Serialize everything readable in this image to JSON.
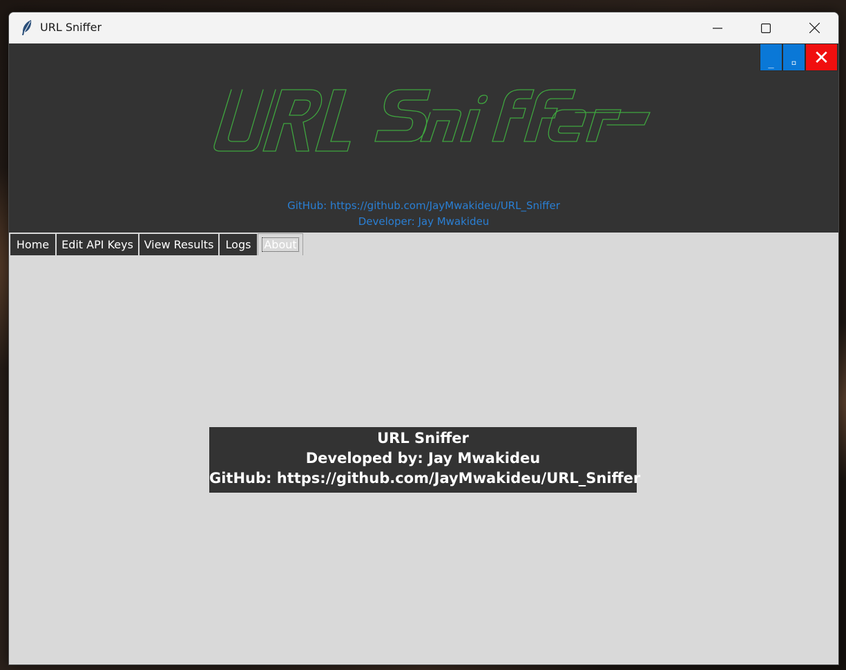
{
  "window": {
    "title": "URL Sniffer"
  },
  "header": {
    "logo_text": "URL Sniffer",
    "logo_color": "#3fa63f",
    "github_line": "GitHub: https://github.com/JayMwakideu/URL_Sniffer",
    "developer_line": "Developer: Jay Mwakideu",
    "link_color": "#2a7fd4",
    "controls": {
      "minimize_label": "_",
      "maximize_label": "▫",
      "close_label": "✕"
    }
  },
  "tabs": [
    {
      "label": "Home",
      "selected": false
    },
    {
      "label": "Edit API Keys",
      "selected": false
    },
    {
      "label": "View Results",
      "selected": false
    },
    {
      "label": "Logs",
      "selected": false
    },
    {
      "label": "About",
      "selected": true
    }
  ],
  "about": {
    "app_name": "URL Sniffer",
    "developer": "Developed by: Jay Mwakideu",
    "github": "GitHub: https://github.com/JayMwakideu/URL_Sniffer"
  },
  "colors": {
    "header_bg": "#333333",
    "content_bg": "#d9d9d9",
    "control_blue": "#0a78d7",
    "control_red": "#f00f0f"
  }
}
